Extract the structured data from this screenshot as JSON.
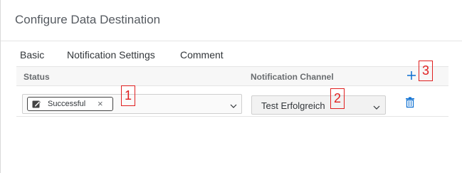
{
  "dialog": {
    "title": "Configure Data Destination"
  },
  "tabs": [
    {
      "label": "Basic",
      "active": false
    },
    {
      "label": "Notification Settings",
      "active": true
    },
    {
      "label": "Comment",
      "active": false
    }
  ],
  "table": {
    "columns": {
      "status": "Status",
      "channel": "Notification Channel"
    },
    "add_icon": "plus-icon",
    "rows": [
      {
        "status_token": "Successful",
        "status_token_icon": "edit-note-icon",
        "channel_value": "Test Erfolgreich",
        "delete_icon": "trash-icon"
      }
    ]
  },
  "annotations": {
    "marker_1": "1",
    "marker_2": "2",
    "marker_3": "3"
  },
  "colors": {
    "accent": "#0a6ed1",
    "marker": "#e02020"
  }
}
